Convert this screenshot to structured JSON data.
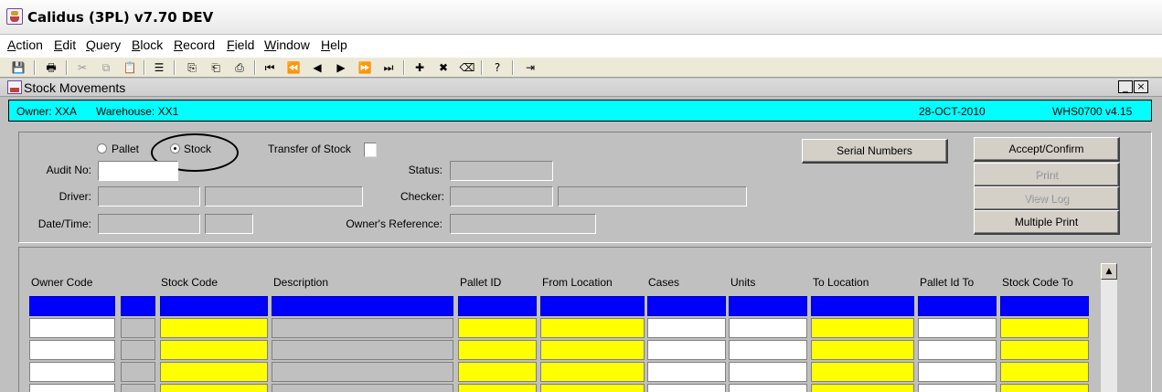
{
  "app": {
    "title": "Calidus (3PL) v7.70 DEV"
  },
  "menu": [
    "Action",
    "Edit",
    "Query",
    "Block",
    "Record",
    "Field",
    "Window",
    "Help"
  ],
  "toolbar": {
    "save": "💾",
    "print": "🖶",
    "cut": "✂",
    "copy": "⧉",
    "paste": "📋",
    "list": "☰",
    "query1": "⎘",
    "query2": "⎗",
    "query3": "⎙",
    "first": "⏮",
    "prev_set": "⏪",
    "prev": "◀",
    "next": "▶",
    "next_set": "⏩",
    "last": "⏭",
    "insert": "✚",
    "delete": "✖",
    "clear": "⌫",
    "help": "?",
    "exit": "⇥"
  },
  "window": {
    "title": "Stock Movements",
    "minimize": "_",
    "close": "×"
  },
  "info": {
    "owner": "Owner:  XXA",
    "warehouse": "Warehouse:  XX1",
    "date": "28-OCT-2010",
    "version": "WHS0700  v4.15"
  },
  "form": {
    "pallet_label": "Pallet",
    "stock_label": "Stock",
    "transfer_label": "Transfer of Stock",
    "audit_label": "Audit No:",
    "driver_label": "Driver:",
    "datetime_label": "Date/Time:",
    "status_label": "Status:",
    "checker_label": "Checker:",
    "owner_ref_label": "Owner's Reference:"
  },
  "buttons": {
    "serial": "Serial Numbers",
    "accept": "Accept/Confirm",
    "print": "Print",
    "view_log": "View Log",
    "multiple_print": "Multiple Print"
  },
  "table": {
    "columns": [
      "Owner Code",
      "Stock Code",
      "Description",
      "Pallet ID",
      "From Location",
      "Cases",
      "Units",
      "To Location",
      "Pallet Id To",
      "Stock Code To"
    ]
  },
  "scroll": {
    "up": "▲"
  },
  "colors": {
    "header_blue": "#0000ff",
    "required_yellow": "#ffff00",
    "info_cyan": "#00ffff"
  }
}
